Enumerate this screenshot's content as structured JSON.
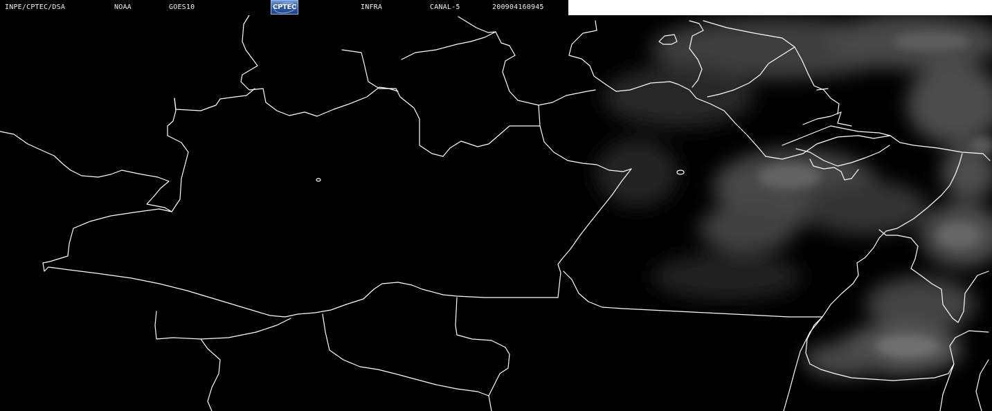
{
  "header": {
    "source": "INPE/CPTEC/DSA",
    "agency": "NOAA",
    "satellite": "GOES10",
    "logo_text": "CPTEC",
    "product": "INFRA",
    "channel": "CANAL-5",
    "timestamp": "200904160945"
  },
  "map": {
    "background_color": "#000000",
    "border_color": "#ffffff",
    "cloud_color": "#5a5a5a",
    "header_blank_color": "#ffffff"
  }
}
